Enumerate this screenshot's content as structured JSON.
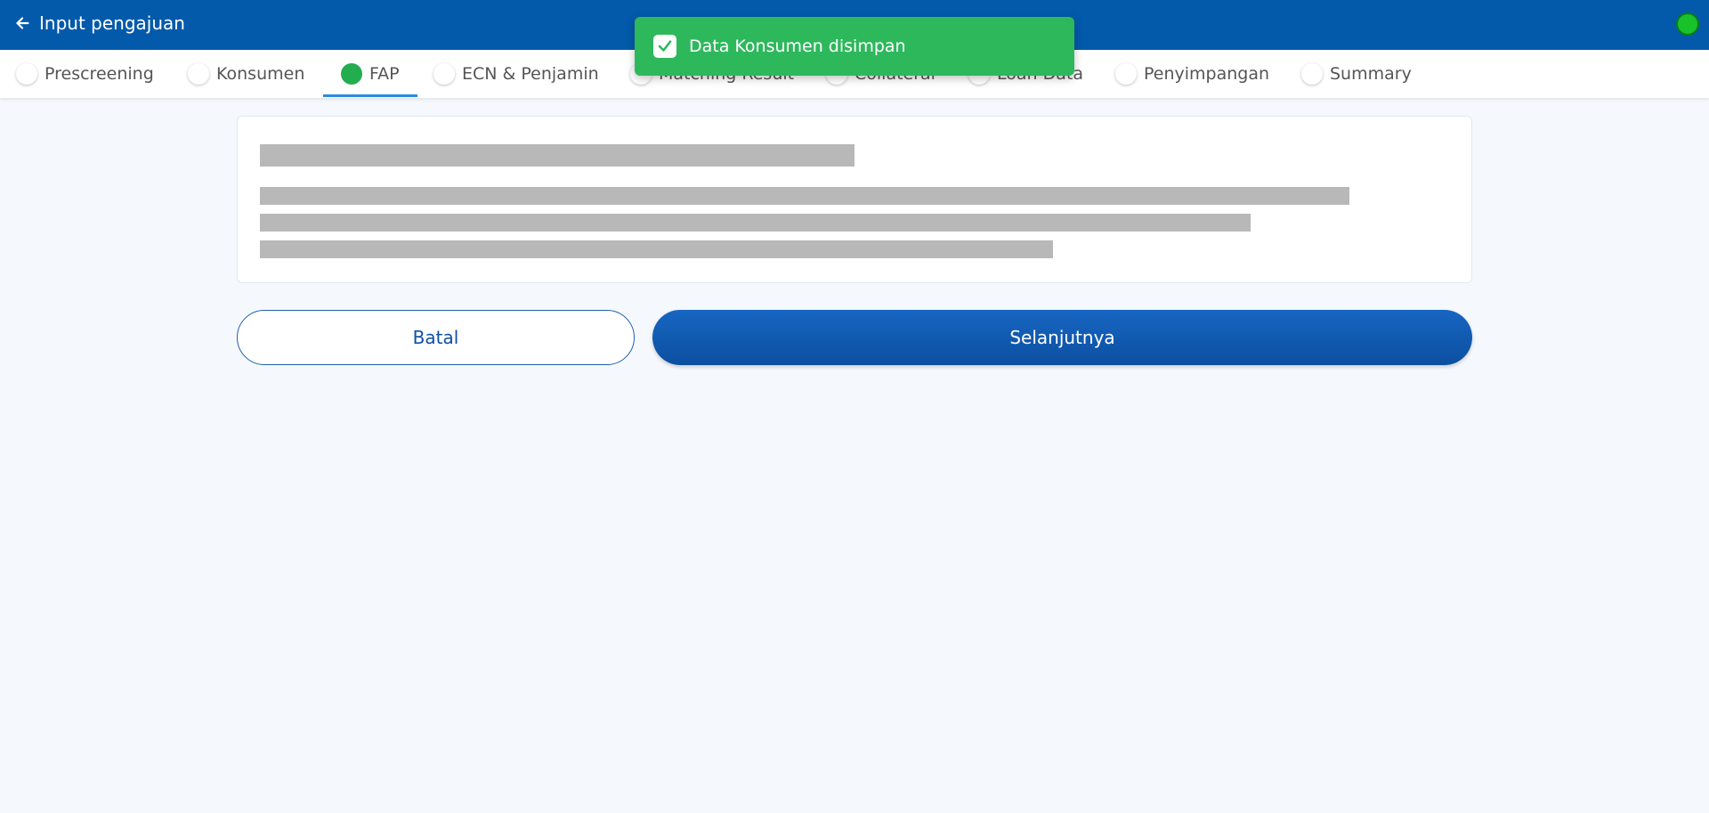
{
  "header": {
    "title": "Input pengajuan",
    "status_color": "#17c22a"
  },
  "stepper": {
    "active": "FAP",
    "steps": [
      {
        "label": "Prescreening"
      },
      {
        "label": "Konsumen"
      },
      {
        "label": "FAP"
      },
      {
        "label": "ECN & Penjamin"
      },
      {
        "label": "Matching Result"
      },
      {
        "label": "Collateral"
      },
      {
        "label": "Loan Data"
      },
      {
        "label": "Penyimpangan"
      },
      {
        "label": "Summary"
      }
    ]
  },
  "toast": {
    "message": "Data Konsumen disimpan",
    "color": "#2eb85c"
  },
  "actions": {
    "cancel_label": "Batal",
    "next_label": "Selanjutnya"
  },
  "colors": {
    "header": "#035aab",
    "primary": "#0c4fa0",
    "active_step": "#23ad4f"
  }
}
